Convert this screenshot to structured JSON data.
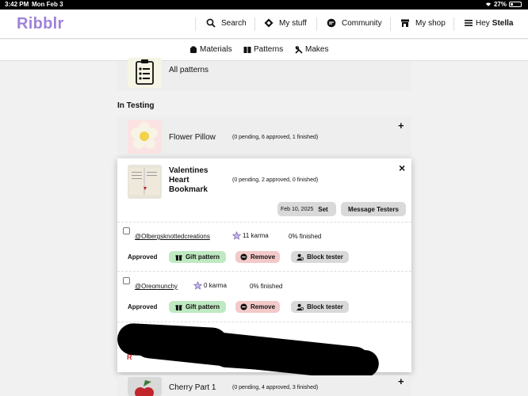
{
  "status_bar": {
    "time": "3:42 PM",
    "date": "Mon Feb 3",
    "battery": "27%",
    "battery_level": 0.27
  },
  "brand": {
    "logo": "Ribblr",
    "accent": "#9f82d8"
  },
  "nav": {
    "search": "Search",
    "my_stuff": "My stuff",
    "community": "Community",
    "my_shop": "My shop",
    "greeting": "Hey",
    "user": "Stella"
  },
  "subnav": {
    "materials": "Materials",
    "patterns": "Patterns",
    "makes": "Makes"
  },
  "all_patterns": {
    "label": "All patterns"
  },
  "in_testing": {
    "title": "In Testing"
  },
  "patterns": [
    {
      "name": "Flower Pillow",
      "stats": "(0 pending, 6 approved, 1 finished)"
    },
    {
      "name": "Valentines Heart Bookmark",
      "stats": "(0 pending, 2 approved, 0 finished)"
    },
    {
      "name": "Cherry Part 1",
      "stats": "(0 pending, 4 approved, 3 finished)"
    }
  ],
  "expanded": {
    "date": "Feb 10, 2025",
    "set_label": "Set",
    "message_testers": "Message Testers",
    "close_symbol": "×",
    "testers": [
      {
        "handle": "@Olbergsknottedcreations",
        "karma": "11 karma",
        "finished": "0% finished",
        "status": "Approved"
      },
      {
        "handle": "@Oreomunchy",
        "karma": "0 karma",
        "finished": "0% finished",
        "status": "Approved"
      }
    ],
    "gift_label": "Gift pattern",
    "remove_label": "Remove",
    "block_label": "Block tester",
    "partial_red_text": "R"
  },
  "icons": {
    "plus": "+",
    "colors": {
      "green_btn": "#bfe9c2",
      "red_btn": "#f3c9c9",
      "gray_btn": "#d9d9d9"
    }
  }
}
